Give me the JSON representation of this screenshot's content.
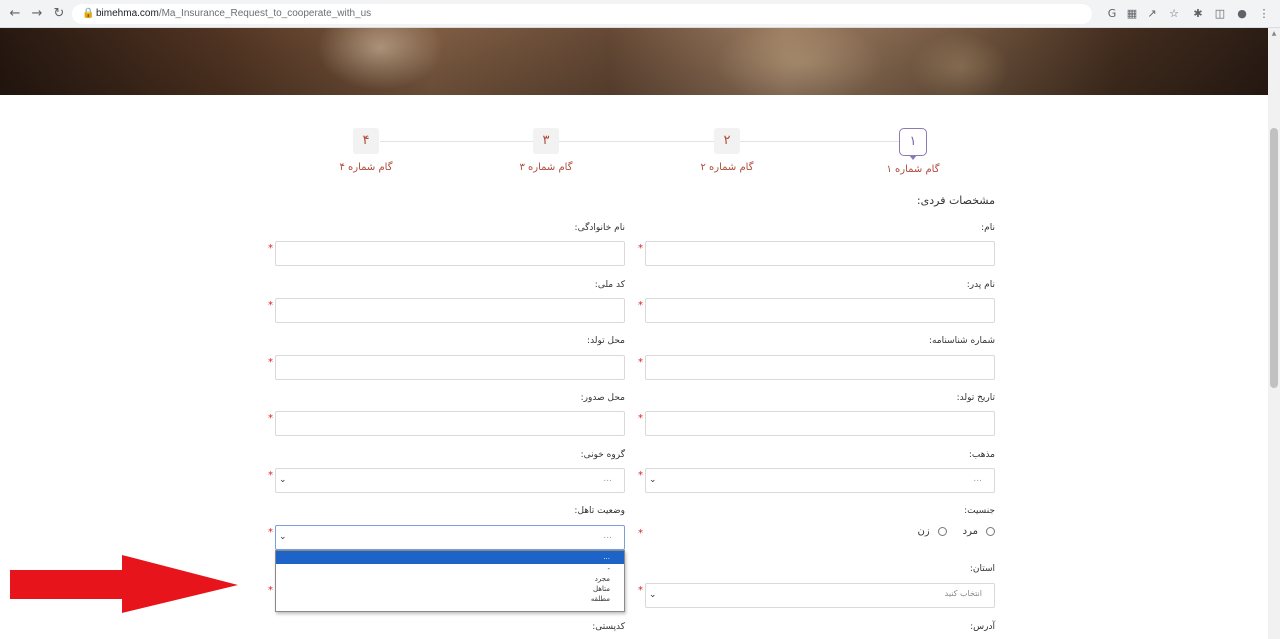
{
  "browser": {
    "url_host": "bimehma.com",
    "url_path": "/Ma_Insurance_Request_to_cooperate_with_us"
  },
  "stepper": {
    "steps": [
      {
        "num": "۱",
        "label": "گام شماره ۱"
      },
      {
        "num": "۲",
        "label": "گام شماره ۲"
      },
      {
        "num": "۳",
        "label": "گام شماره ۳"
      },
      {
        "num": "۴",
        "label": "گام شماره ۴"
      }
    ],
    "active_index": 0
  },
  "form": {
    "section_title": "مشخصات فردی:",
    "first_name_label": "نام:",
    "last_name_label": "نام خانوادگی:",
    "father_name_label": "نام پدر:",
    "national_code_label": "کد ملی:",
    "id_number_label": "شماره شناسنامه:",
    "birth_place_label": "محل تولد:",
    "birth_date_label": "تاریخ تولد:",
    "issue_place_label": "محل صدور:",
    "religion_label": "مذهب:",
    "religion_value": "...",
    "blood_group_label": "گروه خونی:",
    "blood_group_value": "...",
    "gender_label": "جنسیت:",
    "gender_male": "مرد",
    "gender_female": "زن",
    "marital_label": "وضعیت تاهل:",
    "marital_value": "...",
    "marital_options": [
      "...",
      "-",
      "مجرد",
      "متاهل",
      "مطلقه"
    ],
    "province_label": "استان:",
    "province_placeholder": "انتخاب کنید",
    "address_label": "آدرس:",
    "postal_code_label": "کدپستی:",
    "required_mark": "*"
  },
  "colors": {
    "accent": "#7a69ad",
    "step_text": "#b04a3a",
    "required": "#e02020",
    "selected_option": "#1e63c8",
    "annotation_arrow": "#e8141c"
  }
}
